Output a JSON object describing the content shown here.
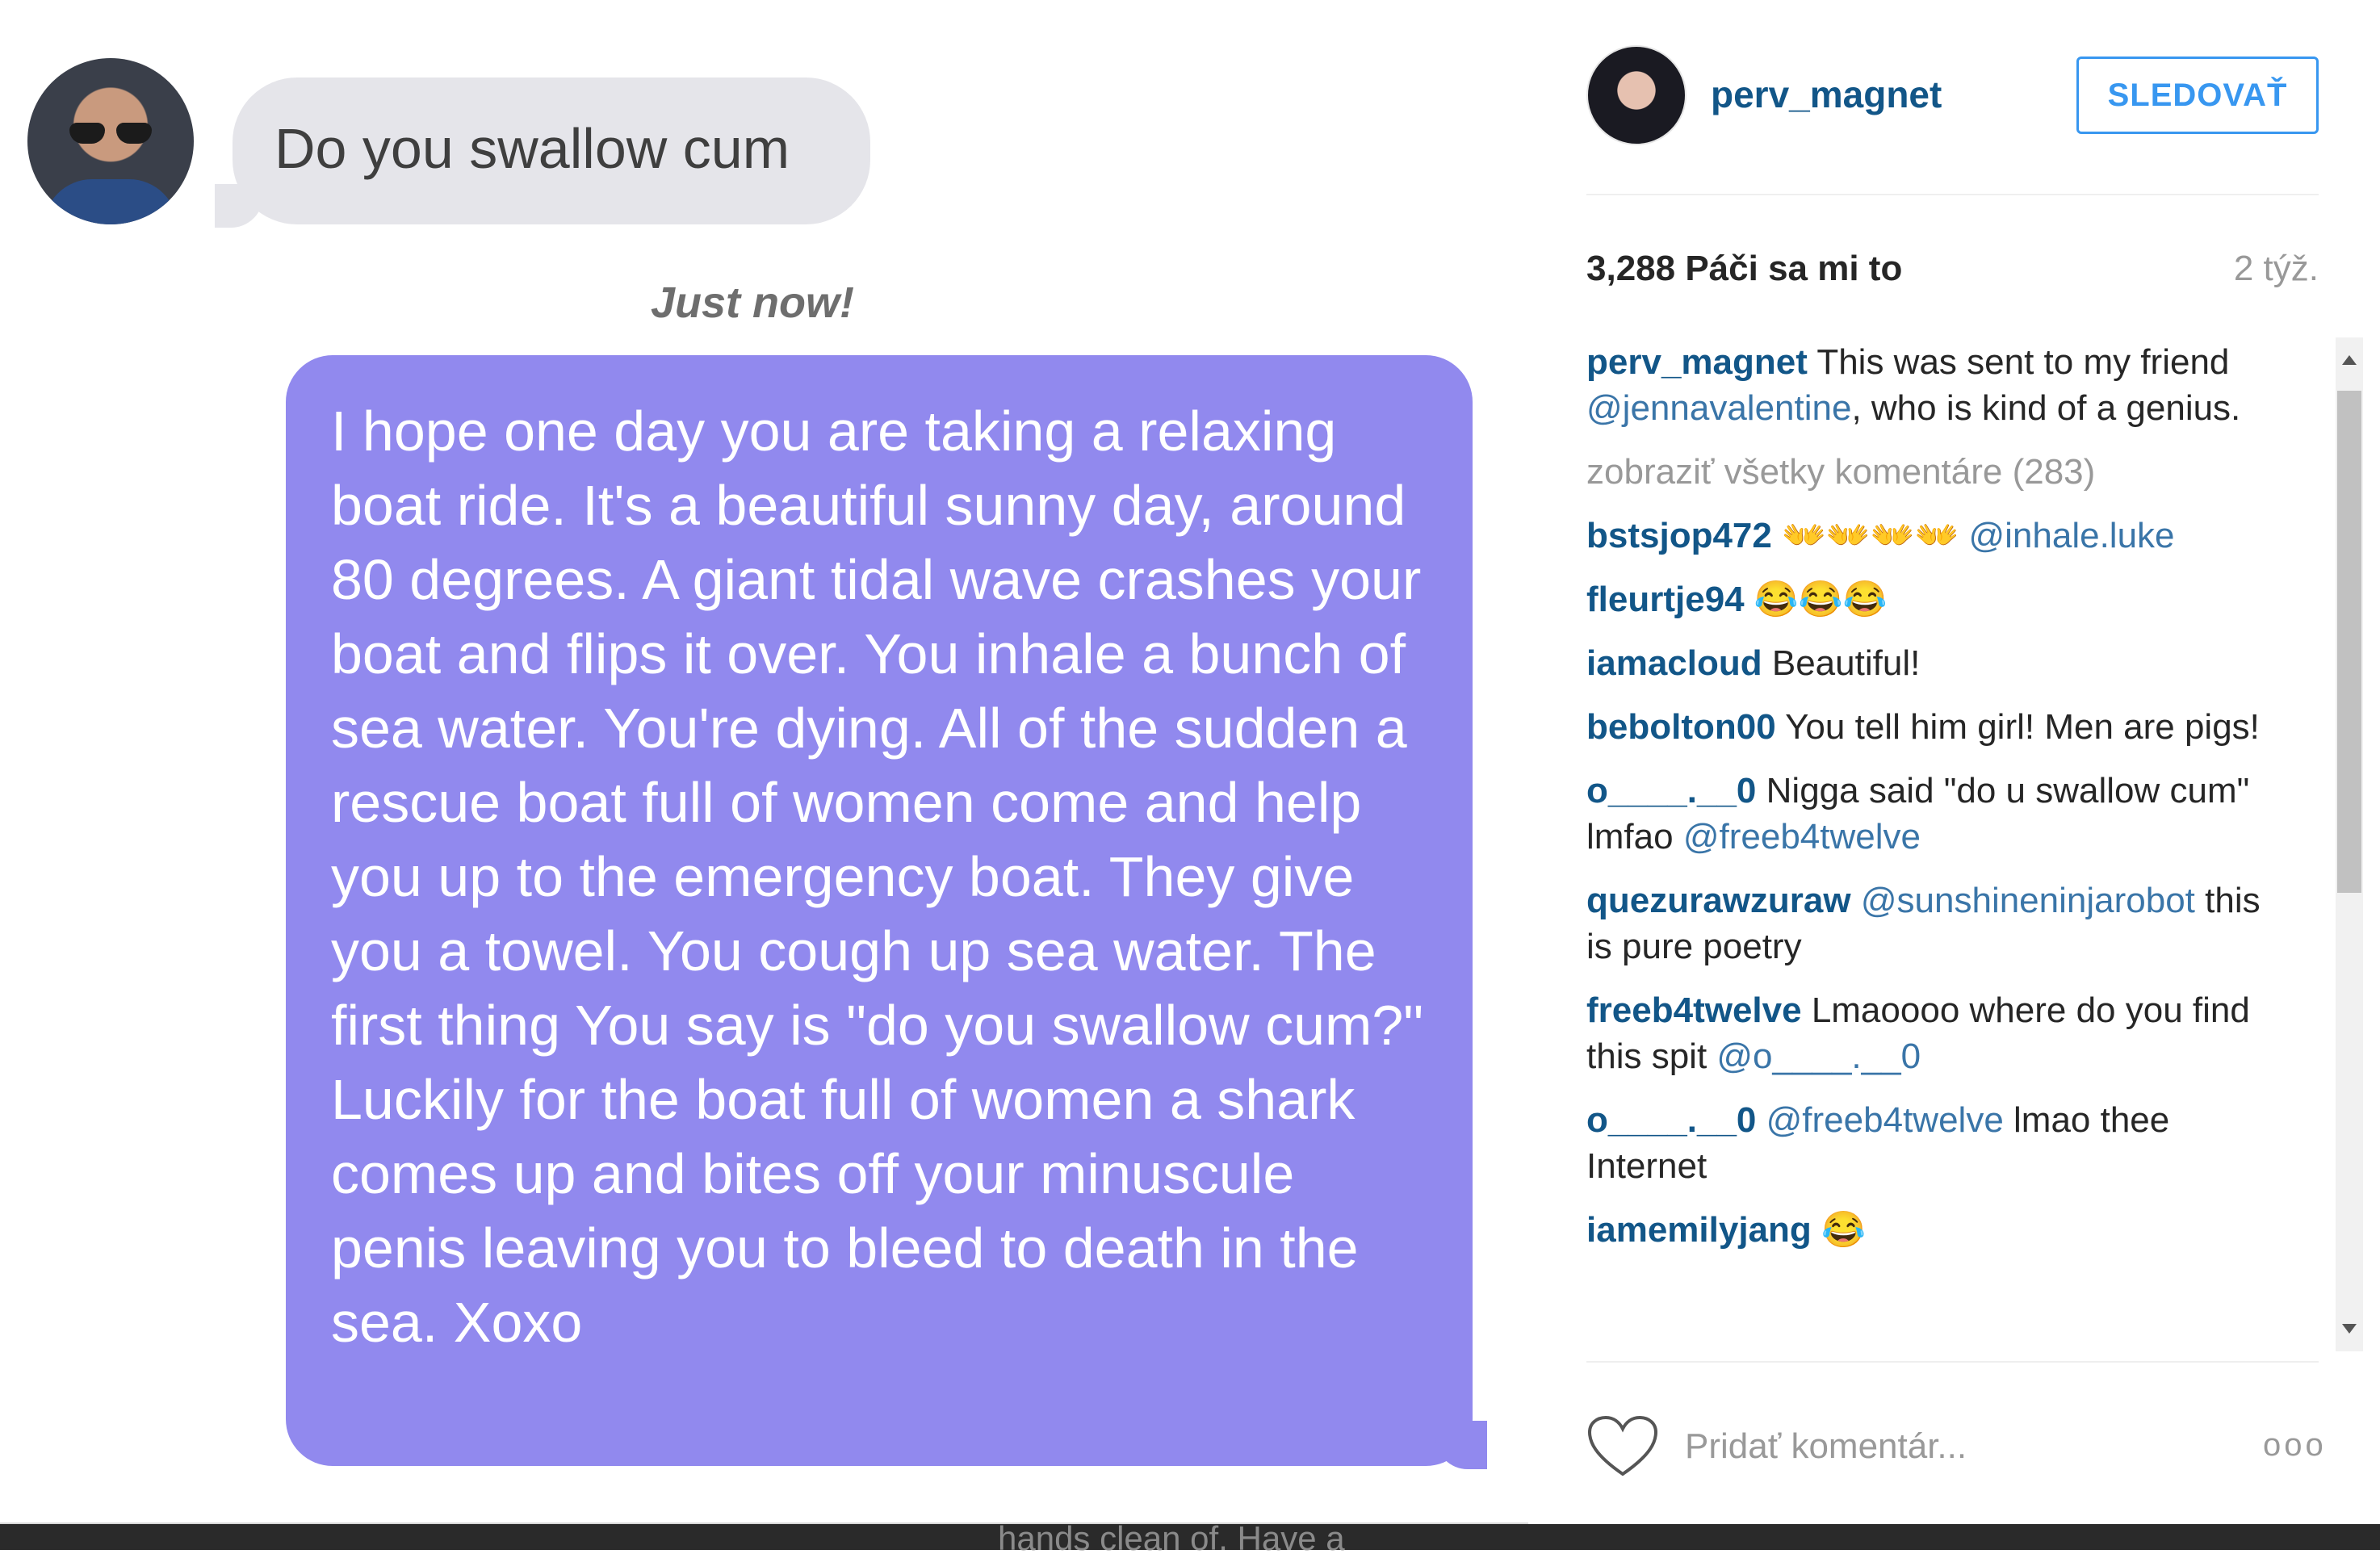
{
  "photo": {
    "grey_message": "Do you swallow cum",
    "timestamp": "Just now!",
    "purple_message": "I hope one day you are taking a relaxing boat ride. It's a beautiful sunny day, around 80 degrees. A giant tidal wave crashes your boat and flips it over. You inhale a bunch of sea water. You're dying. All of the sudden a rescue boat full of women come and help you up to the emergency boat. They give you a towel. You cough up sea water. The first thing You say is \"do you swallow cum?\" Luckily for the boat full of women a shark comes up and bites off your minuscule penis leaving you to bleed to death in the sea. Xoxo",
    "bottom_fragment": "hands clean of. Have a"
  },
  "post": {
    "owner": "perv_magnet",
    "follow_label": "SLEDOVAŤ",
    "likes": "3,288 Páči sa mi to",
    "age": "2 týž.",
    "view_all": "zobraziť všetky komentáre (283)",
    "comment_placeholder": "Pridať komentár...",
    "more_label": "ooo"
  },
  "comments": [
    {
      "user": "perv_magnet",
      "parts": [
        {
          "t": "text",
          "v": "This was sent to my friend "
        },
        {
          "t": "mention",
          "v": "@jennavalentine"
        },
        {
          "t": "text",
          "v": ", who is kind of a genius."
        }
      ]
    },
    {
      "user": "bstsjop472",
      "parts": [
        {
          "t": "text",
          "v": "👐👐👐👐 "
        },
        {
          "t": "mention",
          "v": "@inhale.luke"
        }
      ]
    },
    {
      "user": "fleurtje94",
      "parts": [
        {
          "t": "text",
          "v": "😂😂😂"
        }
      ]
    },
    {
      "user": "iamacloud",
      "parts": [
        {
          "t": "text",
          "v": "Beautiful!"
        }
      ]
    },
    {
      "user": "bebolton00",
      "parts": [
        {
          "t": "text",
          "v": "You tell him girl! Men are pigs!"
        }
      ]
    },
    {
      "user": "o____.__0",
      "parts": [
        {
          "t": "text",
          "v": "Nigga said \"do u swallow cum\" lmfao "
        },
        {
          "t": "mention",
          "v": "@freeb4twelve"
        }
      ]
    },
    {
      "user": "quezurawzuraw",
      "parts": [
        {
          "t": "mention",
          "v": "@sunshineninjarobot"
        },
        {
          "t": "text",
          "v": " this is pure poetry"
        }
      ]
    },
    {
      "user": "freeb4twelve",
      "parts": [
        {
          "t": "text",
          "v": "Lmaoooo where do you find this spit "
        },
        {
          "t": "mention",
          "v": "@o____.__0"
        }
      ]
    },
    {
      "user": "o____.__0",
      "parts": [
        {
          "t": "mention",
          "v": "@freeb4twelve"
        },
        {
          "t": "text",
          "v": " lmao thee Internet"
        }
      ]
    },
    {
      "user": "iamemilyjang",
      "parts": [
        {
          "t": "text",
          "v": "😂"
        }
      ]
    }
  ],
  "icons": {
    "like": "heart-icon",
    "more": "more-options-icon",
    "scroll_up": "scroll-up-arrow-icon",
    "scroll_down": "scroll-down-arrow-icon"
  },
  "colors": {
    "username": "#125688",
    "mention": "#3a75a8",
    "follow": "#3897f0",
    "purple_bubble": "#9189ee",
    "grey_bubble": "#e5e5ea"
  }
}
